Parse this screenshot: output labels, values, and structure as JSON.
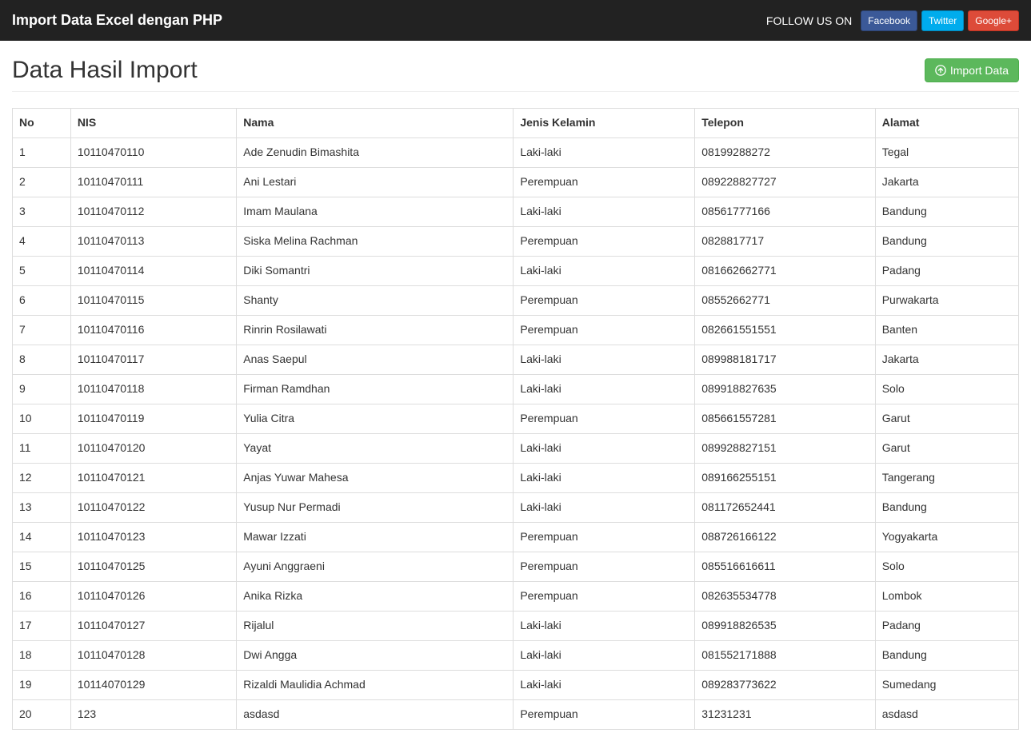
{
  "navbar": {
    "brand": "Import Data Excel dengan PHP",
    "follow_text": "FOLLOW US ON",
    "social": {
      "facebook": "Facebook",
      "twitter": "Twitter",
      "google": "Google+"
    }
  },
  "page": {
    "title": "Data Hasil Import",
    "import_button": "Import Data"
  },
  "table": {
    "headers": {
      "no": "No",
      "nis": "NIS",
      "nama": "Nama",
      "jenis_kelamin": "Jenis Kelamin",
      "telepon": "Telepon",
      "alamat": "Alamat"
    },
    "rows": [
      {
        "no": "1",
        "nis": "10110470110",
        "nama": "Ade Zenudin Bimashita",
        "jenis_kelamin": "Laki-laki",
        "telepon": "08199288272",
        "alamat": "Tegal"
      },
      {
        "no": "2",
        "nis": "10110470111",
        "nama": "Ani Lestari",
        "jenis_kelamin": "Perempuan",
        "telepon": "089228827727",
        "alamat": "Jakarta"
      },
      {
        "no": "3",
        "nis": "10110470112",
        "nama": "Imam Maulana",
        "jenis_kelamin": "Laki-laki",
        "telepon": "08561777166",
        "alamat": "Bandung"
      },
      {
        "no": "4",
        "nis": "10110470113",
        "nama": "Siska Melina Rachman",
        "jenis_kelamin": "Perempuan",
        "telepon": "0828817717",
        "alamat": "Bandung"
      },
      {
        "no": "5",
        "nis": "10110470114",
        "nama": "Diki Somantri",
        "jenis_kelamin": "Laki-laki",
        "telepon": "081662662771",
        "alamat": "Padang"
      },
      {
        "no": "6",
        "nis": "10110470115",
        "nama": "Shanty",
        "jenis_kelamin": "Perempuan",
        "telepon": "08552662771",
        "alamat": "Purwakarta"
      },
      {
        "no": "7",
        "nis": "10110470116",
        "nama": "Rinrin Rosilawati",
        "jenis_kelamin": "Perempuan",
        "telepon": "082661551551",
        "alamat": "Banten"
      },
      {
        "no": "8",
        "nis": "10110470117",
        "nama": "Anas Saepul",
        "jenis_kelamin": "Laki-laki",
        "telepon": "089988181717",
        "alamat": "Jakarta"
      },
      {
        "no": "9",
        "nis": "10110470118",
        "nama": "Firman Ramdhan",
        "jenis_kelamin": "Laki-laki",
        "telepon": "089918827635",
        "alamat": "Solo"
      },
      {
        "no": "10",
        "nis": "10110470119",
        "nama": "Yulia Citra",
        "jenis_kelamin": "Perempuan",
        "telepon": "085661557281",
        "alamat": "Garut"
      },
      {
        "no": "11",
        "nis": "10110470120",
        "nama": "Yayat",
        "jenis_kelamin": "Laki-laki",
        "telepon": "089928827151",
        "alamat": "Garut"
      },
      {
        "no": "12",
        "nis": "10110470121",
        "nama": "Anjas Yuwar Mahesa",
        "jenis_kelamin": "Laki-laki",
        "telepon": "089166255151",
        "alamat": "Tangerang"
      },
      {
        "no": "13",
        "nis": "10110470122",
        "nama": "Yusup Nur Permadi",
        "jenis_kelamin": "Laki-laki",
        "telepon": "081172652441",
        "alamat": "Bandung"
      },
      {
        "no": "14",
        "nis": "10110470123",
        "nama": "Mawar Izzati",
        "jenis_kelamin": "Perempuan",
        "telepon": "088726166122",
        "alamat": "Yogyakarta"
      },
      {
        "no": "15",
        "nis": "10110470125",
        "nama": "Ayuni Anggraeni",
        "jenis_kelamin": "Perempuan",
        "telepon": "085516616611",
        "alamat": "Solo"
      },
      {
        "no": "16",
        "nis": "10110470126",
        "nama": "Anika Rizka",
        "jenis_kelamin": "Perempuan",
        "telepon": "082635534778",
        "alamat": "Lombok"
      },
      {
        "no": "17",
        "nis": "10110470127",
        "nama": "Rijalul",
        "jenis_kelamin": "Laki-laki",
        "telepon": "089918826535",
        "alamat": "Padang"
      },
      {
        "no": "18",
        "nis": "10110470128",
        "nama": "Dwi Angga",
        "jenis_kelamin": "Laki-laki",
        "telepon": "081552171888",
        "alamat": "Bandung"
      },
      {
        "no": "19",
        "nis": "10114070129",
        "nama": "Rizaldi Maulidia Achmad",
        "jenis_kelamin": "Laki-laki",
        "telepon": "089283773622",
        "alamat": "Sumedang"
      },
      {
        "no": "20",
        "nis": "123",
        "nama": "asdasd",
        "jenis_kelamin": "Perempuan",
        "telepon": "31231231",
        "alamat": "asdasd"
      }
    ]
  }
}
